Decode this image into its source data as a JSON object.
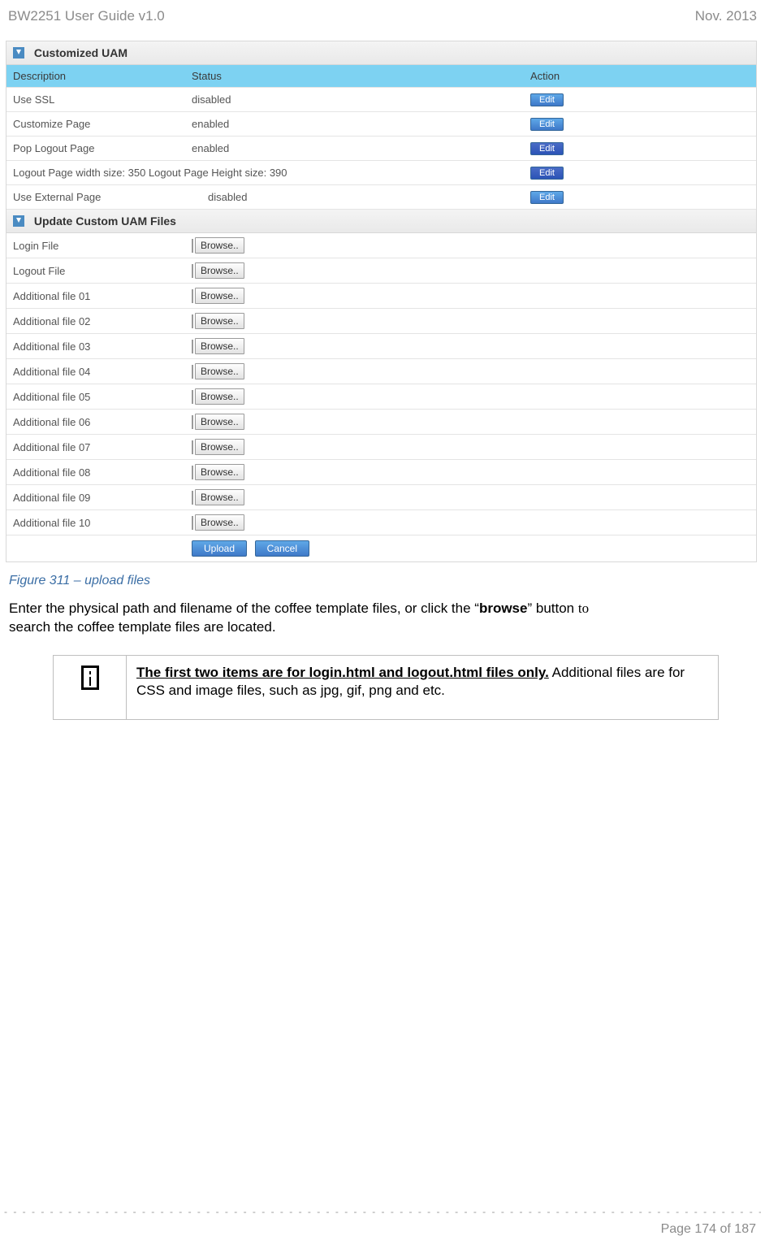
{
  "header": {
    "left": "BW2251 User Guide v1.0",
    "right": "Nov.  2013"
  },
  "panel1": {
    "title": "Customized UAM",
    "columns": {
      "desc": "Description",
      "status": "Status",
      "action": "Action"
    },
    "rows": [
      {
        "desc": "Use SSL",
        "status": "disabled",
        "action": "Edit"
      },
      {
        "desc": "Customize Page",
        "status": "enabled",
        "action": "Edit"
      },
      {
        "desc": "Pop Logout Page",
        "status": "enabled",
        "action": "Edit"
      },
      {
        "desc": "Logout Page width size: 350  Logout Page Height size: 390",
        "status": "",
        "action": "Edit"
      },
      {
        "desc": "Use External Page",
        "status": "disabled",
        "action": "Edit"
      }
    ]
  },
  "panel2": {
    "title": "Update Custom UAM Files",
    "rows": [
      {
        "label": "Login File",
        "browse": "Browse.."
      },
      {
        "label": "Logout File",
        "browse": "Browse.."
      },
      {
        "label": "Additional file 01",
        "browse": "Browse.."
      },
      {
        "label": "Additional file 02",
        "browse": "Browse.."
      },
      {
        "label": "Additional file 03",
        "browse": "Browse.."
      },
      {
        "label": "Additional file 04",
        "browse": "Browse.."
      },
      {
        "label": "Additional file 05",
        "browse": "Browse.."
      },
      {
        "label": "Additional file 06",
        "browse": "Browse.."
      },
      {
        "label": "Additional file 07",
        "browse": "Browse.."
      },
      {
        "label": "Additional file 08",
        "browse": "Browse.."
      },
      {
        "label": "Additional file 09",
        "browse": "Browse.."
      },
      {
        "label": "Additional file 10",
        "browse": "Browse.."
      }
    ],
    "buttons": {
      "upload": "Upload",
      "cancel": "Cancel"
    }
  },
  "caption": "Figure 311  – upload files",
  "body": {
    "line1a": "Enter the physical path and filename of the coffee template files, or click the “",
    "browse": "browse",
    "line1b": "” button ",
    "to": "to",
    "line2": "search the coffee template files are located."
  },
  "note": {
    "lead": "The first two items are for login.html and logout.html files only.",
    "rest": " Additional files are for CSS and image files, such as jpg, gif, png and etc."
  },
  "footer": {
    "page": "Page 174 of 187"
  }
}
